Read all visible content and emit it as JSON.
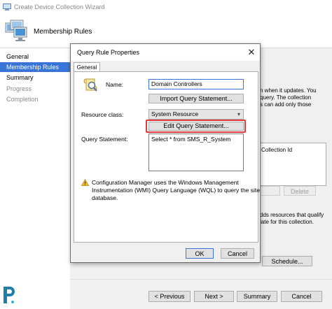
{
  "wizard": {
    "title": "Create Device Collection Wizard",
    "header_title": "Membership Rules",
    "nav": [
      {
        "label": "General",
        "state": "normal"
      },
      {
        "label": "Membership Rules",
        "state": "active"
      },
      {
        "label": "Summary",
        "state": "normal"
      },
      {
        "label": "Progress",
        "state": "disabled"
      },
      {
        "label": "Completion",
        "state": "disabled"
      }
    ],
    "background": {
      "text_line1": "n when it updates. You",
      "text_line2": "query. The collection",
      "text_line3": "s can add only those",
      "list_header": "Collection Id",
      "delete_label": "Delete",
      "text_line4": "dds resources that qualify",
      "text_line5": "late for this collection.",
      "schedule_label": "Schedule..."
    },
    "buttons": {
      "previous": "< Previous",
      "next": "Next >",
      "summary": "Summary",
      "cancel": "Cancel"
    }
  },
  "dialog": {
    "title": "Query Rule Properties",
    "close_glyph": "✕",
    "tab_label": "General",
    "name_label": "Name:",
    "name_value": "Domain Controllers",
    "import_label": "Import Query Statement...",
    "resource_class_label": "Resource class:",
    "resource_class_value": "System Resource",
    "edit_label": "Edit Query Statement...",
    "query_statement_label": "Query Statement:",
    "query_statement_value": "Select * from SMS_R_System",
    "warning_lines": [
      "Configuration Manager uses the Windows Management",
      "Instrumentation (WMI) Query Language (WQL) to query the site",
      "database."
    ],
    "ok_label": "OK",
    "cancel_label": "Cancel"
  },
  "colors": {
    "accent": "#3875d7",
    "highlight": "#e03a3a"
  },
  "icons": [
    "app-icon",
    "computer-stack-icon",
    "query-scroll-icon",
    "warning-icon",
    "close-icon",
    "dropdown-arrow-icon",
    "prajwal-logo-icon"
  ]
}
